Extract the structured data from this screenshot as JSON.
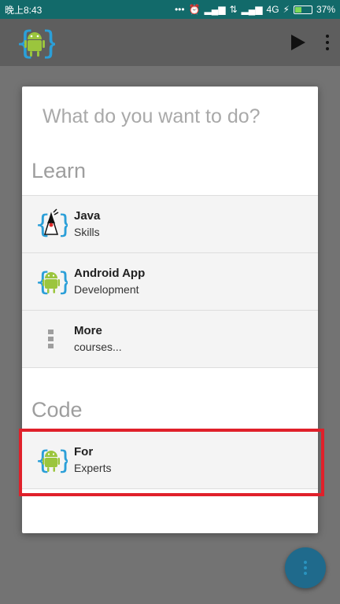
{
  "status_bar": {
    "left_text": "晚上8:43",
    "network": "4G",
    "battery_text": "37%",
    "battery_level": 0.37
  },
  "app_bar": {
    "logo_icon": "android-braces-logo-icon",
    "actions": [
      "play-icon",
      "more-vert-icon"
    ]
  },
  "dialog": {
    "title": "What do you want to do?",
    "learn_section": {
      "label": "Learn",
      "items": [
        {
          "title": "Java",
          "subtitle": "Skills",
          "icon": "java-duke-braces-icon"
        },
        {
          "title": "Android App",
          "subtitle": "Development",
          "icon": "android-braces-icon"
        },
        {
          "title": "More",
          "subtitle": "courses...",
          "icon": "more-vert-icon"
        }
      ]
    },
    "code_section": {
      "label": "Code",
      "items": [
        {
          "title": "For",
          "subtitle": "Experts",
          "icon": "android-braces-icon"
        }
      ]
    }
  },
  "colors": {
    "status_bar": "#126a6a",
    "highlight": "#e0202a",
    "fab": "#1f6a8c",
    "android_green": "#9bc53d",
    "brace_blue": "#2b9fd8"
  }
}
